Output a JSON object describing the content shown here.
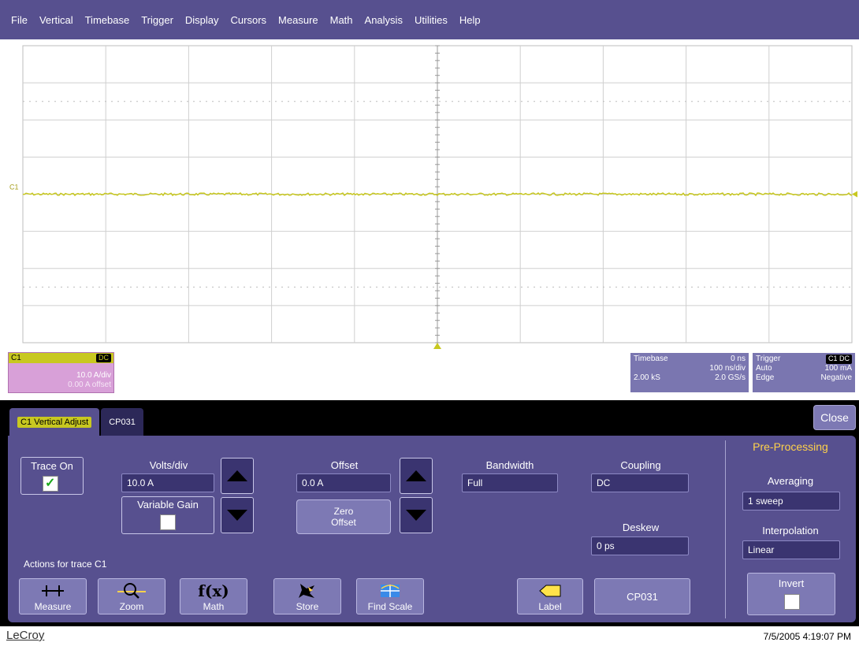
{
  "menu": [
    "File",
    "Vertical",
    "Timebase",
    "Trigger",
    "Display",
    "Cursors",
    "Measure",
    "Math",
    "Analysis",
    "Utilities",
    "Help"
  ],
  "grid": {
    "channel_marker": "C1",
    "trace_color": "#c8c820"
  },
  "channel_descriptor": {
    "name": "C1",
    "coupling": "DC",
    "scale": "10.0 A/div",
    "offset": "0.00 A offset"
  },
  "timebase": {
    "title": "Timebase",
    "delay": "0 ns",
    "per_div": "100 ns/div",
    "samples": "2.00 kS",
    "rate": "2.0 GS/s"
  },
  "trigger": {
    "title": "Trigger",
    "badge": "C1 DC",
    "mode": "Auto",
    "level": "100 mA",
    "type": "Edge",
    "slope": "Negative"
  },
  "tabs": {
    "active": "C1 Vertical Adjust",
    "second": "CP031",
    "close": "Close"
  },
  "controls": {
    "trace_on": "Trace On",
    "volts_div_label": "Volts/div",
    "volts_div_value": "10.0 A",
    "variable_gain": "Variable Gain",
    "offset_label": "Offset",
    "offset_value": "0.0 A",
    "zero_offset_1": "Zero",
    "zero_offset_2": "Offset",
    "bandwidth_label": "Bandwidth",
    "bandwidth_value": "Full",
    "coupling_label": "Coupling",
    "coupling_value": "DC",
    "deskew_label": "Deskew",
    "deskew_value": "0 ps",
    "actions_label": "Actions for trace C1"
  },
  "actions": {
    "measure": "Measure",
    "zoom": "Zoom",
    "math": "Math",
    "math_icon": "f(x)",
    "store": "Store",
    "find_scale": "Find Scale",
    "label": "Label",
    "cp031": "CP031"
  },
  "preprocessing": {
    "title": "Pre-Processing",
    "averaging_label": "Averaging",
    "averaging_value": "1 sweep",
    "interpolation_label": "Interpolation",
    "interpolation_value": "Linear",
    "invert_label": "Invert"
  },
  "footer": {
    "brand": "LeCroy",
    "timestamp": "7/5/2005 4:19:07 PM"
  },
  "colors": {
    "panel": "#57508f",
    "channel": "#c8c820",
    "accent": "#ffd24a"
  }
}
